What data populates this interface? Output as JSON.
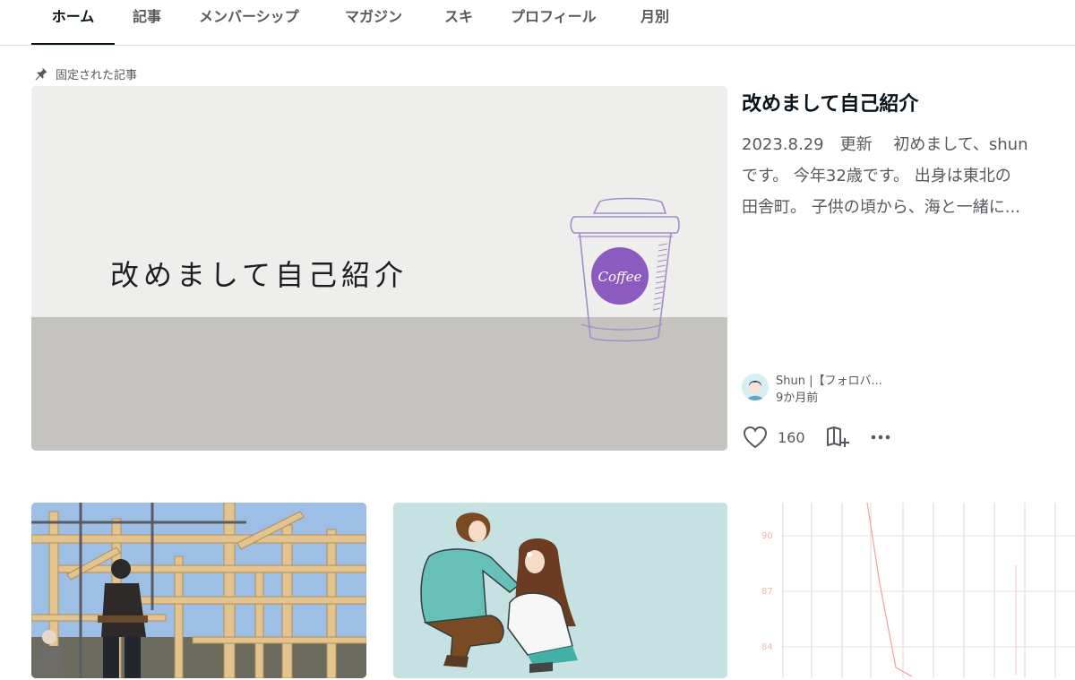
{
  "tabs": [
    {
      "label": "ホーム",
      "active": true
    },
    {
      "label": "記事",
      "active": false
    },
    {
      "label": "メンバーシップ",
      "active": false
    },
    {
      "label": "マガジン",
      "active": false
    },
    {
      "label": "スキ",
      "active": false
    },
    {
      "label": "プロフィール",
      "active": false
    },
    {
      "label": "月別",
      "active": false
    }
  ],
  "pinned": {
    "label": "固定された記事",
    "icon": "pin-icon",
    "image_text": "改めまして自己紹介",
    "cup_text": "Coffee",
    "title": "改めまして自己紹介",
    "excerpt_lines": [
      "2023.8.29　更新　 初めまして、shun",
      "です。 今年32歳です。 出身は東北の",
      "田舎町。 子供の頃から、海と一緒に..."
    ],
    "author": "Shun |【フォロバ...",
    "time": "9か月前",
    "like_count": "160"
  },
  "cards": [
    {
      "alt": "timber-frame-construction"
    },
    {
      "alt": "couple-illustration"
    },
    {
      "alt": "line-chart",
      "y_ticks": [
        "90",
        "87",
        "84"
      ]
    }
  ],
  "colors": {
    "text": "#08131a",
    "muted": "#56595d",
    "accent_purple": "#8d5bbf"
  }
}
